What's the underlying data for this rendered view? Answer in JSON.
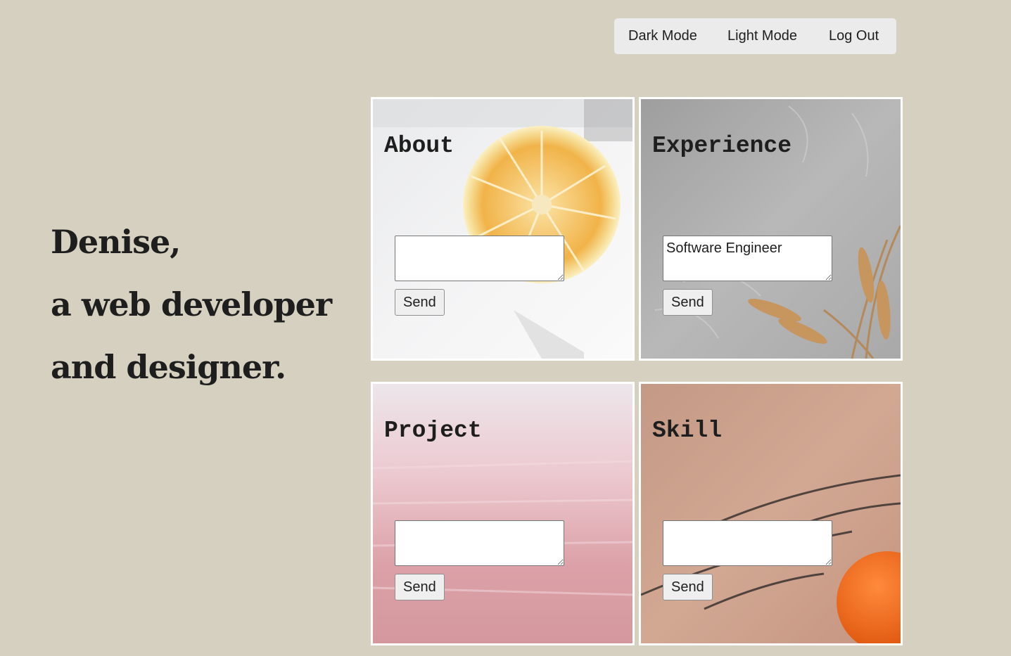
{
  "nav": {
    "dark_mode": "Dark Mode",
    "light_mode": "Light Mode",
    "log_out": "Log Out"
  },
  "hero": {
    "line1": "Denise,",
    "line2": "a web developer",
    "line3": "and designer."
  },
  "cards": {
    "about": {
      "title": "About",
      "input_value": "",
      "button": "Send"
    },
    "experience": {
      "title": "Experience",
      "input_value": "Software Engineer",
      "button": "Send"
    },
    "project": {
      "title": "Project",
      "input_value": "",
      "button": "Send"
    },
    "skill": {
      "title": "Skill",
      "input_value": "",
      "button": "Send"
    }
  },
  "colors": {
    "page_background": "#d5d0bf",
    "nav_background": "#ebebeb",
    "text": "#1e1e1e",
    "card_border": "#ffffff"
  }
}
